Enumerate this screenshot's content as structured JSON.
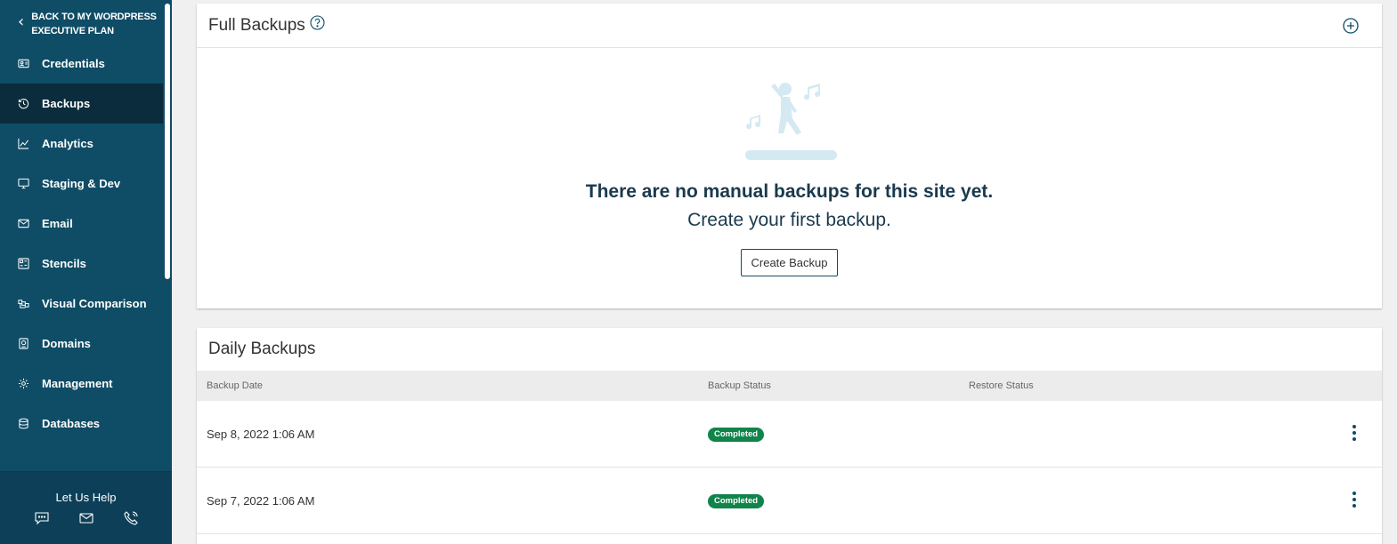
{
  "sidebar": {
    "back_label": "BACK TO MY WORDPRESS EXECUTIVE PLAN",
    "items": [
      {
        "label": "Credentials",
        "icon": "id-card-icon"
      },
      {
        "label": "Backups",
        "icon": "history-icon",
        "active": true
      },
      {
        "label": "Analytics",
        "icon": "chart-line-icon"
      },
      {
        "label": "Staging & Dev",
        "icon": "monitor-icon"
      },
      {
        "label": "Email",
        "icon": "envelope-icon"
      },
      {
        "label": "Stencils",
        "icon": "stencil-icon"
      },
      {
        "label": "Visual Comparison",
        "icon": "compare-icon"
      },
      {
        "label": "Domains",
        "icon": "domain-icon"
      },
      {
        "label": "Management",
        "icon": "gear-icon"
      },
      {
        "label": "Databases",
        "icon": "database-icon"
      }
    ],
    "help": {
      "title": "Let Us Help",
      "icons": [
        "chat-icon",
        "mail-icon",
        "phone-icon"
      ]
    }
  },
  "full_backups": {
    "title": "Full Backups",
    "empty_title": "There are no manual backups for this site yet.",
    "empty_subtitle": "Create your first backup.",
    "create_button": "Create Backup"
  },
  "daily_backups": {
    "title": "Daily Backups",
    "columns": [
      "Backup Date",
      "Backup Status",
      "Restore Status"
    ],
    "rows": [
      {
        "date": "Sep 8, 2022 1:06 AM",
        "status": "Completed",
        "restore_status": ""
      },
      {
        "date": "Sep 7, 2022 1:06 AM",
        "status": "Completed",
        "restore_status": ""
      }
    ]
  },
  "colors": {
    "sidebar_bg": "#0f4c66",
    "sidebar_active": "#0b2c3c",
    "status_completed": "#10844a",
    "heading_text": "#1a3a4e"
  }
}
